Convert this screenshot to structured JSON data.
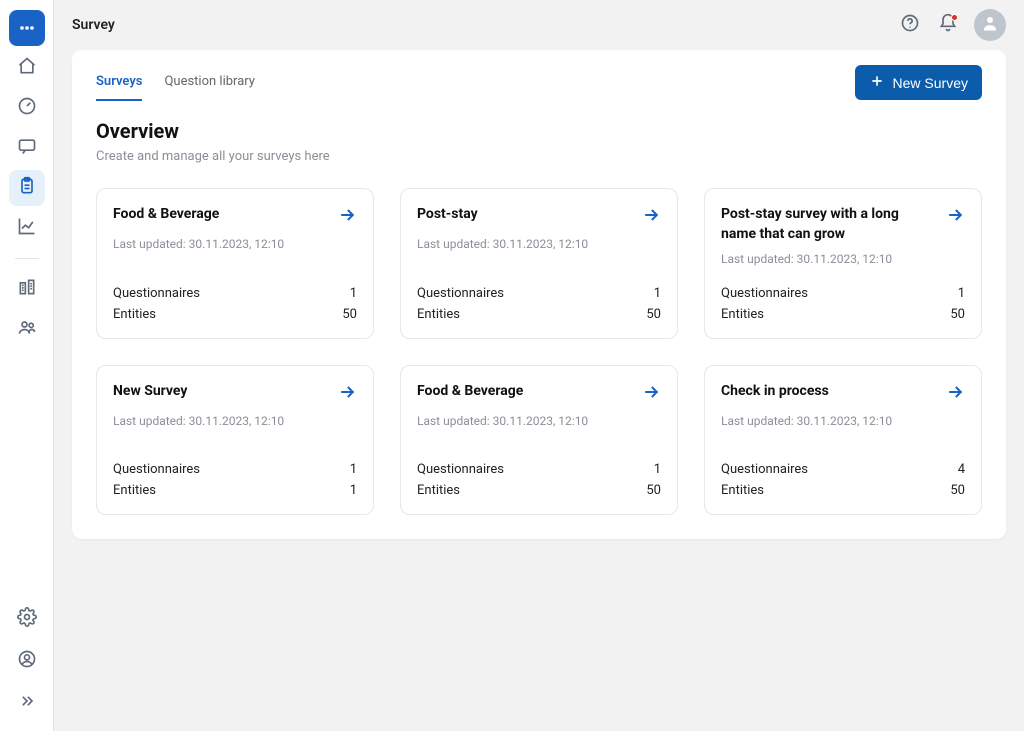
{
  "topbar": {
    "title": "Survey"
  },
  "tabs": {
    "surveys": "Surveys",
    "question_library": "Question library"
  },
  "new_survey_button": "New Survey",
  "overview": {
    "heading": "Overview",
    "subheading": "Create and manage all your surveys here"
  },
  "labels": {
    "questionnaires": "Questionnaires",
    "entities": "Entities"
  },
  "surveys": [
    {
      "title": "Food & Beverage",
      "updated": "Last updated: 30.11.2023, 12:10",
      "questionnaires": "1",
      "entities": "50"
    },
    {
      "title": "Post-stay",
      "updated": "Last updated: 30.11.2023, 12:10",
      "questionnaires": "1",
      "entities": "50"
    },
    {
      "title": "Post-stay survey with a long name that can grow",
      "updated": "Last updated: 30.11.2023, 12:10",
      "questionnaires": "1",
      "entities": "50"
    },
    {
      "title": "New Survey",
      "updated": "Last updated: 30.11.2023, 12:10",
      "questionnaires": "1",
      "entities": "1"
    },
    {
      "title": "Food & Beverage",
      "updated": "Last updated: 30.11.2023, 12:10",
      "questionnaires": "1",
      "entities": "50"
    },
    {
      "title": "Check in process",
      "updated": "Last updated: 30.11.2023, 12:10",
      "questionnaires": "4",
      "entities": "50"
    }
  ]
}
